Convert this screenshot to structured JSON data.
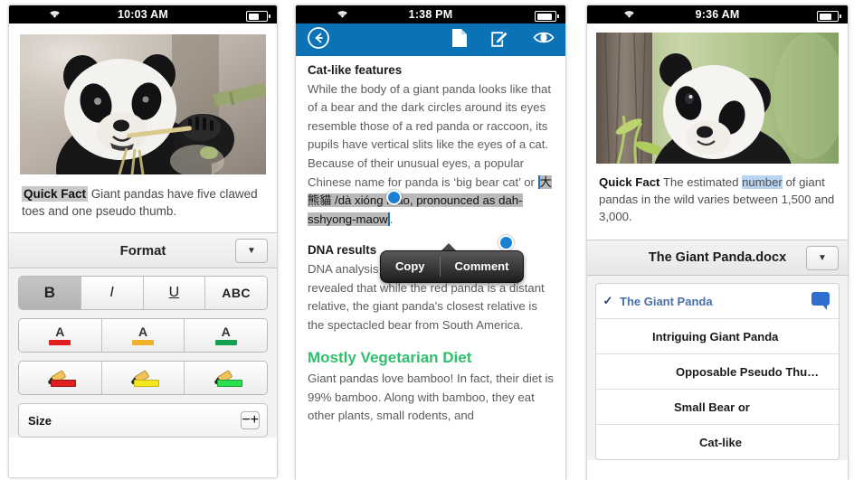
{
  "panel1": {
    "status": {
      "time": "10:03 AM",
      "wifi_icon": "wifi-icon",
      "battery_icon": "battery-icon"
    },
    "hero_alt": "panda-eating-bamboo-photo",
    "quick_fact_tag": "Quick Fact",
    "quick_fact_text": " Giant pandas have five clawed toes and one pseudo thumb.",
    "format": {
      "title": "Format",
      "chevron": "▼",
      "style_buttons": [
        {
          "name": "bold",
          "label": "B",
          "active": true
        },
        {
          "name": "italic",
          "label": "I",
          "active": false
        },
        {
          "name": "underline",
          "label": "U",
          "active": false
        },
        {
          "name": "strikethrough",
          "label": "ABC",
          "active": false
        }
      ],
      "font_colors": [
        {
          "name": "font-color-red",
          "letter": "A",
          "color": "#e01f1f"
        },
        {
          "name": "font-color-yellow",
          "letter": "A",
          "color": "#eeb229"
        },
        {
          "name": "font-color-green",
          "letter": "A",
          "color": "#13a050"
        }
      ],
      "highlighters": [
        {
          "name": "highlight-red",
          "glyph": "✎",
          "color": "#e01f1f"
        },
        {
          "name": "highlight-yellow",
          "glyph": "✎",
          "color": "#f4e622"
        },
        {
          "name": "highlight-green",
          "glyph": "✎",
          "color": "#2ae04e"
        }
      ],
      "size_label": "Size",
      "size_minus": "−",
      "size_plus": "+"
    }
  },
  "panel2": {
    "status": {
      "time": "1:38 PM",
      "wifi_icon": "wifi-icon",
      "battery_icon": "battery-icon"
    },
    "toolbar": {
      "back_icon": "back-arrow-icon",
      "document_icon": "document-icon",
      "edit_icon": "edit-pencil-icon",
      "view_icon": "eye-icon",
      "accent_color": "#0b72b5"
    },
    "sections": [
      {
        "heading": "Cat-like features",
        "body_pre": "While the body of a giant panda looks like that of a bear and the dark circles around its eyes resemble those of a red panda or raccoon, its pupils have vertical slits like the eyes of a cat. Because of their unusual eyes, a popular Chinese name for panda is ‘big bear cat’ or ",
        "selected_text": "大熊貓 /dà xióng māo, pronounced as dah-sshyong-maow",
        "body_post": "."
      },
      {
        "heading": "DNA results",
        "body": "DNA analysis has been of interest. It has revealed that while the red panda is a distant relative, the giant panda's closest relative is the spectacled bear from South America."
      },
      {
        "heading": "Mostly Vegetarian Diet",
        "heading_color": "#2fc06c",
        "body": "Giant pandas love bamboo! In fact, their diet is 99% bamboo. Along with bamboo, they eat other plants, small rodents, and"
      }
    ],
    "popup": {
      "copy_label": "Copy",
      "comment_label": "Comment"
    }
  },
  "panel3": {
    "status": {
      "time": "9:36 AM",
      "wifi_icon": "wifi-icon",
      "battery_icon": "battery-icon"
    },
    "hero_alt": "baby-panda-on-tree-photo",
    "quick_fact_tag": "Quick Fact",
    "quick_fact_pre": " The estimated ",
    "quick_fact_highlight": "number",
    "quick_fact_post": " of giant pandas in the wild varies between 1,500 and 3,000.",
    "doc_title": "The Giant Panda.docx",
    "chevron": "▼",
    "outline": [
      {
        "label": "The Giant Panda",
        "selected": true,
        "check": "✓",
        "indent": 0,
        "comment_badge": true
      },
      {
        "label": "Intriguing Giant Panda",
        "selected": false,
        "check": "",
        "indent": 1,
        "comment_badge": false
      },
      {
        "label": "Opposable Pseudo Thu…",
        "selected": false,
        "check": "",
        "indent": 2,
        "comment_badge": false
      },
      {
        "label": "Small Bear or",
        "selected": false,
        "check": "",
        "indent": 3,
        "comment_badge": false
      },
      {
        "label": "Cat-like",
        "selected": false,
        "check": "",
        "indent": 4,
        "comment_badge": false
      }
    ]
  }
}
